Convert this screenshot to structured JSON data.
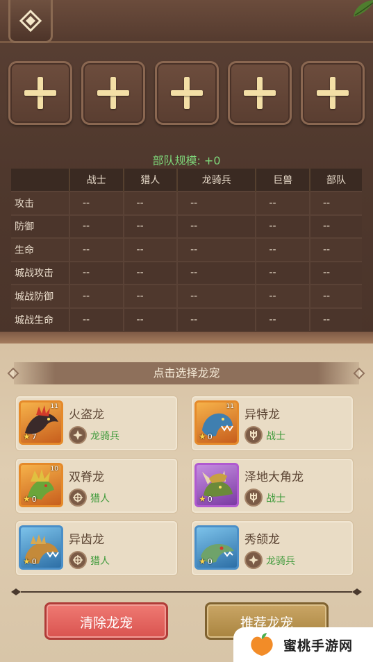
{
  "top": {
    "back_icon": "diamond-nav-icon",
    "slots": [
      "+",
      "+",
      "+",
      "+",
      "+"
    ]
  },
  "scale_text": "部队规模: +0",
  "stats_table": {
    "columns": [
      "",
      "战士",
      "猎人",
      "龙骑兵",
      "巨兽",
      "部队"
    ],
    "rows": [
      {
        "label": "攻击",
        "values": [
          "--",
          "--",
          "--",
          "--",
          "--"
        ]
      },
      {
        "label": "防御",
        "values": [
          "--",
          "--",
          "--",
          "--",
          "--"
        ]
      },
      {
        "label": "生命",
        "values": [
          "--",
          "--",
          "--",
          "--",
          "--"
        ]
      },
      {
        "label": "城战攻击",
        "values": [
          "--",
          "--",
          "--",
          "--",
          "--"
        ]
      },
      {
        "label": "城战防御",
        "values": [
          "--",
          "--",
          "--",
          "--",
          "--"
        ]
      },
      {
        "label": "城战生命",
        "values": [
          "--",
          "--",
          "--",
          "--",
          "--"
        ]
      }
    ]
  },
  "select_header": "点击选择龙宠",
  "pets": [
    {
      "name": "火盗龙",
      "type": "龙骑兵",
      "stars": "7",
      "level": "11",
      "rarity": "orange"
    },
    {
      "name": "异特龙",
      "type": "战士",
      "stars": "0",
      "level": "11",
      "rarity": "orange"
    },
    {
      "name": "双脊龙",
      "type": "猎人",
      "stars": "0",
      "level": "10",
      "rarity": "orange"
    },
    {
      "name": "泽地大角龙",
      "type": "战士",
      "stars": "0",
      "level": "",
      "rarity": "purple"
    },
    {
      "name": "异齿龙",
      "type": "猎人",
      "stars": "0",
      "level": "",
      "rarity": "blue"
    },
    {
      "name": "秀颌龙",
      "type": "龙骑兵",
      "stars": "0",
      "level": "",
      "rarity": "blue"
    }
  ],
  "buttons": {
    "clear": "清除龙宠",
    "recommend": "推荐龙宠"
  },
  "watermark": {
    "text": "蜜桃手游网"
  },
  "colors": {
    "accent_green": "#7ed77a",
    "type_green": "#3e9a3a",
    "clear_red": "#d9534f",
    "recommend_gold": "#a9843f"
  }
}
